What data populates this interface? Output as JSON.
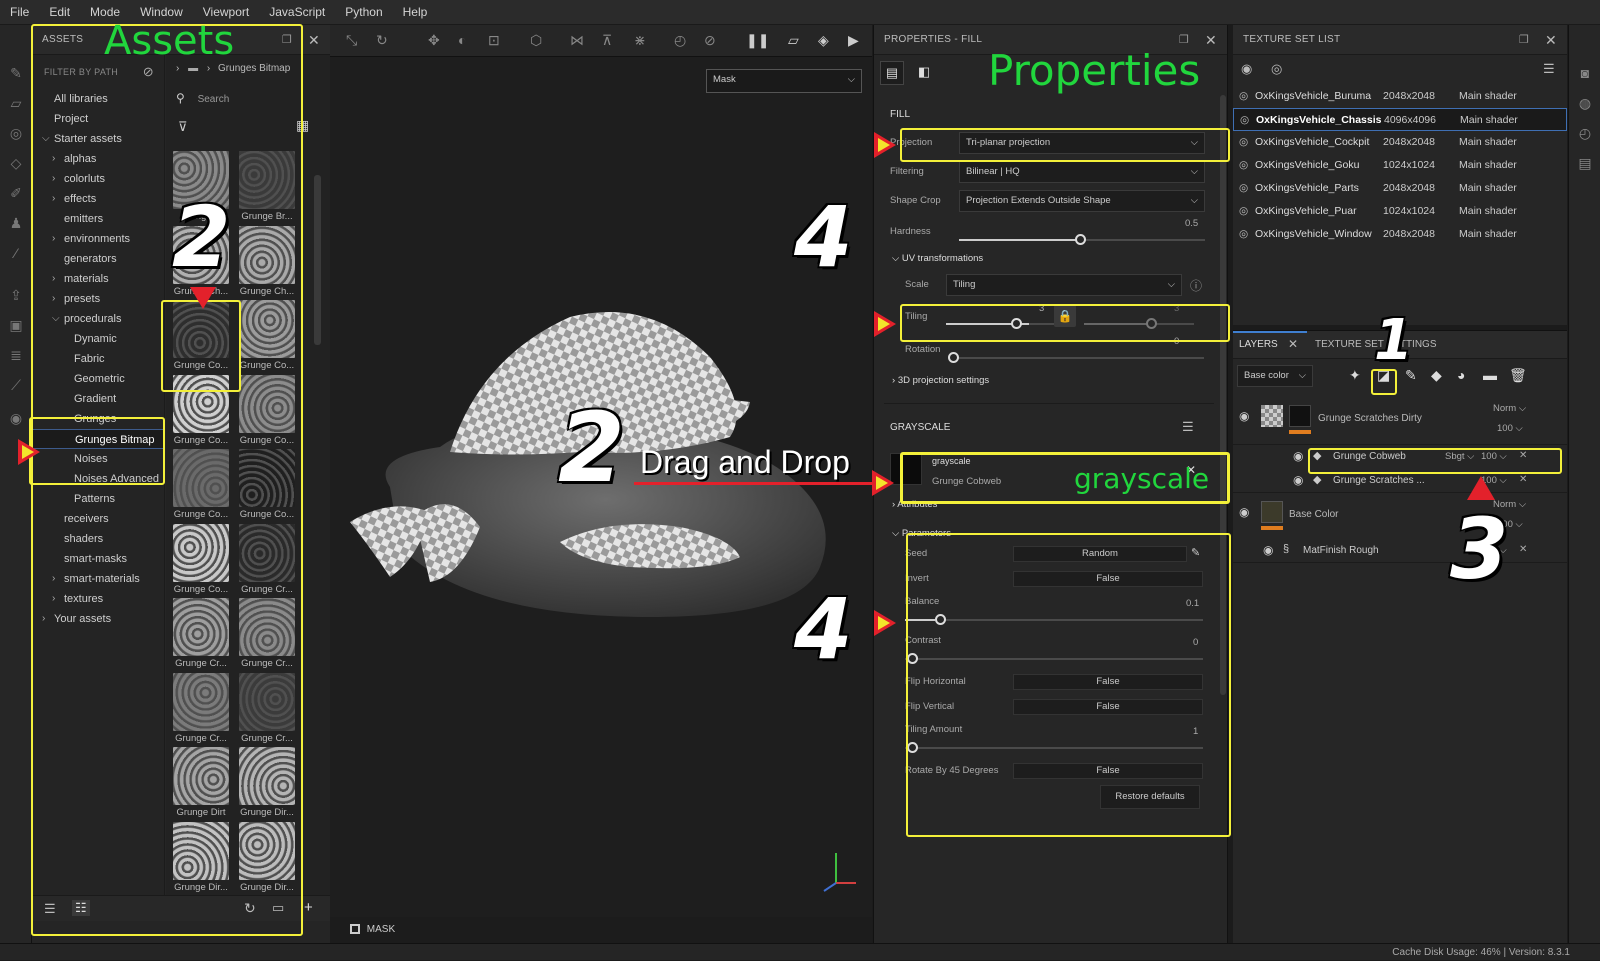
{
  "menu": [
    "File",
    "Edit",
    "Mode",
    "Window",
    "Viewport",
    "JavaScript",
    "Python",
    "Help"
  ],
  "assets": {
    "header": "ASSETS",
    "filter_label": "FILTER BY PATH",
    "breadcrumb": "Grunges Bitmap",
    "search_placeholder": "Search",
    "tree": [
      {
        "label": "All libraries",
        "indent": 0,
        "caret": ""
      },
      {
        "label": "Project",
        "indent": 0,
        "caret": ""
      },
      {
        "label": "Starter assets",
        "indent": 0,
        "caret": "v"
      },
      {
        "label": "alphas",
        "indent": 1,
        "caret": ">"
      },
      {
        "label": "colorluts",
        "indent": 1,
        "caret": ">"
      },
      {
        "label": "effects",
        "indent": 1,
        "caret": ">"
      },
      {
        "label": "emitters",
        "indent": 1,
        "caret": ""
      },
      {
        "label": "environments",
        "indent": 1,
        "caret": ">"
      },
      {
        "label": "generators",
        "indent": 1,
        "caret": ""
      },
      {
        "label": "materials",
        "indent": 1,
        "caret": ">"
      },
      {
        "label": "presets",
        "indent": 1,
        "caret": ">"
      },
      {
        "label": "procedurals",
        "indent": 1,
        "caret": "v"
      },
      {
        "label": "Dynamic",
        "indent": 2,
        "caret": ""
      },
      {
        "label": "Fabric",
        "indent": 2,
        "caret": ""
      },
      {
        "label": "Geometric",
        "indent": 2,
        "caret": ""
      },
      {
        "label": "Gradient",
        "indent": 2,
        "caret": ""
      },
      {
        "label": "Grunges",
        "indent": 2,
        "caret": ""
      },
      {
        "label": "Grunges Bitmap",
        "indent": 2,
        "caret": "",
        "selected": true
      },
      {
        "label": "Noises",
        "indent": 2,
        "caret": ""
      },
      {
        "label": "Noises Advanced",
        "indent": 2,
        "caret": ""
      },
      {
        "label": "Patterns",
        "indent": 2,
        "caret": ""
      },
      {
        "label": "receivers",
        "indent": 1,
        "caret": ""
      },
      {
        "label": "shaders",
        "indent": 1,
        "caret": ""
      },
      {
        "label": "smart-masks",
        "indent": 1,
        "caret": ""
      },
      {
        "label": "smart-materials",
        "indent": 1,
        "caret": ">"
      },
      {
        "label": "textures",
        "indent": 1,
        "caret": ">"
      },
      {
        "label": "Your assets",
        "indent": 0,
        "caret": ">"
      }
    ],
    "thumbs": [
      "Grunge ...",
      "Grunge Br...",
      "Grunge Ch...",
      "Grunge Ch...",
      "Grunge Co...",
      "Grunge Co...",
      "Grunge Co...",
      "Grunge Co...",
      "Grunge Co...",
      "Grunge Co...",
      "Grunge Co...",
      "Grunge Cr...",
      "Grunge Cr...",
      "Grunge Cr...",
      "Grunge Cr...",
      "Grunge Cr...",
      "Grunge Dirt",
      "Grunge Dir...",
      "Grunge Dir...",
      "Grunge Dir..."
    ]
  },
  "viewport": {
    "mode_select": "Mask",
    "bottom_label": "MASK",
    "drag_text": "Drag and Drop"
  },
  "props": {
    "header": "PROPERTIES - FILL",
    "fill_title": "FILL",
    "projection_label": "Projection",
    "projection_value": "Tri-planar projection",
    "filtering_label": "Filtering",
    "filtering_value": "Bilinear | HQ",
    "shapecrop_label": "Shape Crop",
    "shapecrop_value": "Projection Extends Outside Shape",
    "hardness_label": "Hardness",
    "hardness_value": "0.5",
    "uv_title": "UV transformations",
    "scale_label": "Scale",
    "scale_value": "Tiling",
    "tiling_label": "Tiling",
    "tiling_value": "3",
    "tiling_value2": "3",
    "rotation_label": "Rotation",
    "rotation_value": "0",
    "proj3d_title": "3D projection settings",
    "grayscale_title": "GRAYSCALE",
    "gs_name": "grayscale",
    "gs_resource": "Grunge Cobweb",
    "attributes_title": "Attributes",
    "parameters_title": "Parameters",
    "seed_label": "Seed",
    "seed_value": "Random",
    "invert_label": "Invert",
    "invert_value": "False",
    "balance_label": "Balance",
    "balance_value": "0.1",
    "contrast_label": "Contrast",
    "contrast_value": "0",
    "fliph_label": "Flip Horizontal",
    "fliph_value": "False",
    "flipv_label": "Flip Vertical",
    "flipv_value": "False",
    "tilingamt_label": "Tiling Amount",
    "tilingamt_value": "1",
    "rot45_label": "Rotate By 45 Degrees",
    "rot45_value": "False",
    "restore_label": "Restore defaults"
  },
  "annotations": {
    "assets": "Assets",
    "properties": "Properties",
    "grayscale": "grayscale",
    "n1": "1",
    "n2": "2",
    "n3": "3",
    "n4": "4"
  },
  "tsl": {
    "header": "TEXTURE SET LIST",
    "rows": [
      {
        "name": "OxKingsVehicle_Buruma",
        "res": "2048x2048",
        "shader": "Main shader"
      },
      {
        "name": "OxKingsVehicle_Chassis",
        "res": "4096x4096",
        "shader": "Main shader",
        "selected": true
      },
      {
        "name": "OxKingsVehicle_Cockpit",
        "res": "2048x2048",
        "shader": "Main shader"
      },
      {
        "name": "OxKingsVehicle_Goku",
        "res": "1024x1024",
        "shader": "Main shader"
      },
      {
        "name": "OxKingsVehicle_Parts",
        "res": "2048x2048",
        "shader": "Main shader"
      },
      {
        "name": "OxKingsVehicle_Puar",
        "res": "1024x1024",
        "shader": "Main shader"
      },
      {
        "name": "OxKingsVehicle_Window",
        "res": "2048x2048",
        "shader": "Main shader"
      }
    ]
  },
  "layers": {
    "tab_layers": "LAYERS",
    "tab_tss": "TEXTURE SET SETTINGS",
    "channel": "Base color",
    "l1_name": "Grunge Scratches Dirty",
    "l1_blend": "Norm",
    "l1_opacity": "100",
    "l1a_name": "Grunge Cobweb",
    "l1a_blend": "Sbgt",
    "l1a_opacity": "100",
    "l1b_name": "Grunge Scratches ...",
    "l1b_opacity": "100",
    "l2_name": "Base Color",
    "l2_blend": "Norm",
    "l2_opacity": "100",
    "l2a_name": "MatFinish Rough",
    "l2a_opacity": "100"
  },
  "status": "Cache Disk Usage:   46% | Version: 8.3.1"
}
